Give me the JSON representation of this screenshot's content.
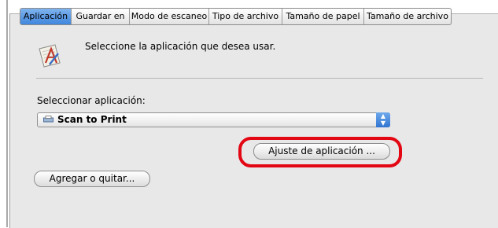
{
  "tabs": [
    {
      "label": "Aplicación",
      "active": true
    },
    {
      "label": "Guardar en",
      "active": false
    },
    {
      "label": "Modo de escaneo",
      "active": false
    },
    {
      "label": "Tipo de archivo",
      "active": false
    },
    {
      "label": "Tamaño de papel",
      "active": false
    },
    {
      "label": "Tamaño de archivo",
      "active": false
    }
  ],
  "intro": {
    "text": "Seleccione la aplicación que desea usar.",
    "icon": "application-icon"
  },
  "select_app": {
    "label": "Seleccionar aplicación:",
    "value": "Scan to Print",
    "icon": "printer-icon"
  },
  "buttons": {
    "app_settings": "Ajuste de aplicación ...",
    "add_remove": "Agregar o quitar..."
  },
  "colors": {
    "active_tab": "#5b9be6",
    "highlight": "#e30613",
    "panel": "#e8e8e8"
  }
}
